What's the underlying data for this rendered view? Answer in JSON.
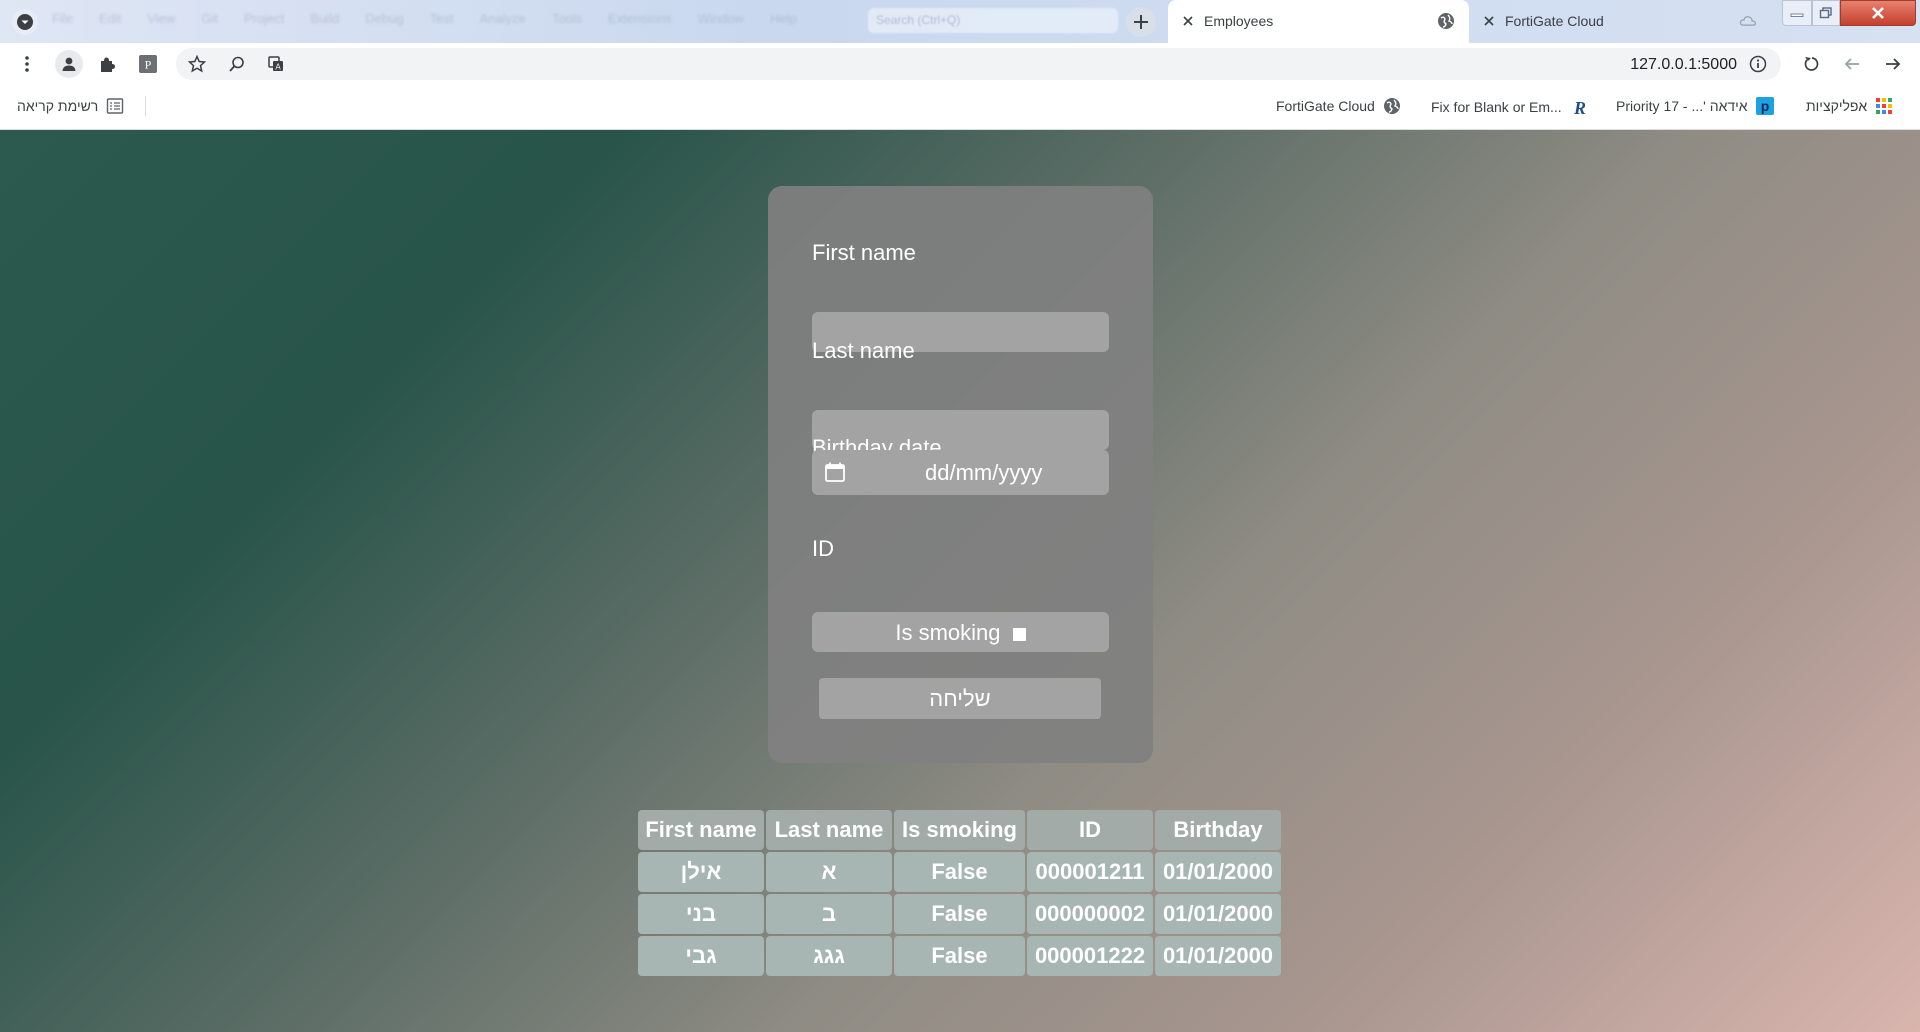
{
  "browser": {
    "menu_ghost": [
      "File",
      "Edit",
      "View",
      "Git",
      "Project",
      "Build",
      "Debug",
      "Test",
      "Analyze",
      "Tools",
      "Extensions",
      "Window",
      "Help"
    ],
    "search_ghost": "Search (Ctrl+Q)",
    "tabs": [
      {
        "title": "Employees",
        "active": true
      },
      {
        "title": "FortiGate Cloud",
        "active": false
      }
    ],
    "url": "127.0.0.1:5000",
    "bookmarks": {
      "apps": "אפליקציות",
      "priority": "Priority 17 - ...' אידאה",
      "fix": "Fix for Blank or Em...",
      "fortigate": "FortiGate Cloud",
      "reading_list": "רשימת קריאה"
    }
  },
  "form": {
    "first_name_label": "First name",
    "last_name_label": "Last name",
    "birthday_label": "Birthday date",
    "birthday_placeholder": "dd/mm/yyyy",
    "id_label": "ID",
    "smoking_label": "Is smoking",
    "submit_label": "שליחה"
  },
  "table": {
    "headers": [
      "First name",
      "Last name",
      "Is smoking",
      "ID",
      "Birthday"
    ],
    "rows": [
      [
        "אילן",
        "א",
        "False",
        "000001211",
        "01/01/2000"
      ],
      [
        "בני",
        "ב",
        "False",
        "000000002",
        "01/01/2000"
      ],
      [
        "גבי",
        "גגג",
        "False",
        "000001222",
        "01/01/2000"
      ]
    ]
  },
  "colors": {
    "card": "#808080",
    "input": "#a3a3a3",
    "cell": "#a7b6b2",
    "bg_start": "#285449",
    "bg_end": "#d9b5ae"
  }
}
